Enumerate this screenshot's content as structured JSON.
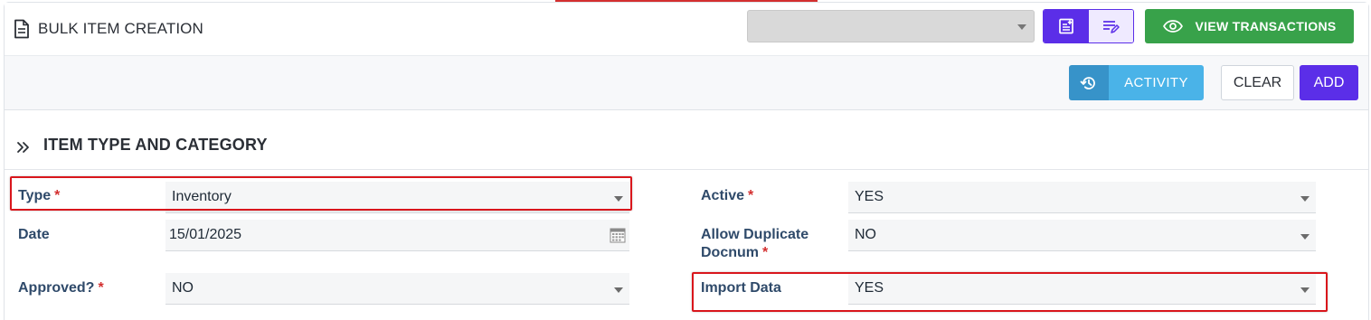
{
  "header": {
    "title": "BULK ITEM CREATION",
    "view_transactions_label": "VIEW TRANSACTIONS"
  },
  "toolbar": {
    "activity_label": "ACTIVITY",
    "clear_label": "CLEAR",
    "add_label": "ADD"
  },
  "section": {
    "title": "ITEM TYPE AND CATEGORY"
  },
  "form": {
    "type": {
      "label": "Type",
      "required": "*",
      "value": "Inventory"
    },
    "date": {
      "label": "Date",
      "value": "15/01/2025"
    },
    "approved": {
      "label": "Approved?",
      "required": "*",
      "value": "NO"
    },
    "active": {
      "label": "Active",
      "required": "*",
      "value": "YES"
    },
    "allow_duplicate": {
      "label_line1": "Allow Duplicate",
      "label_line2": "Docnum",
      "required": "*",
      "value": "NO"
    },
    "import_data": {
      "label": "Import Data",
      "value": "YES"
    }
  },
  "colors": {
    "primary": "#5b2ee8",
    "success": "#38a24a",
    "info": "#4ab3e8",
    "highlight": "#d9161c",
    "required": "#d32f2f"
  },
  "icons": [
    "document-icon",
    "add-note-icon",
    "edit-list-icon",
    "eye-icon",
    "history-icon",
    "double-chevron-right-icon",
    "calendar-icon",
    "chevron-down-icon"
  ]
}
